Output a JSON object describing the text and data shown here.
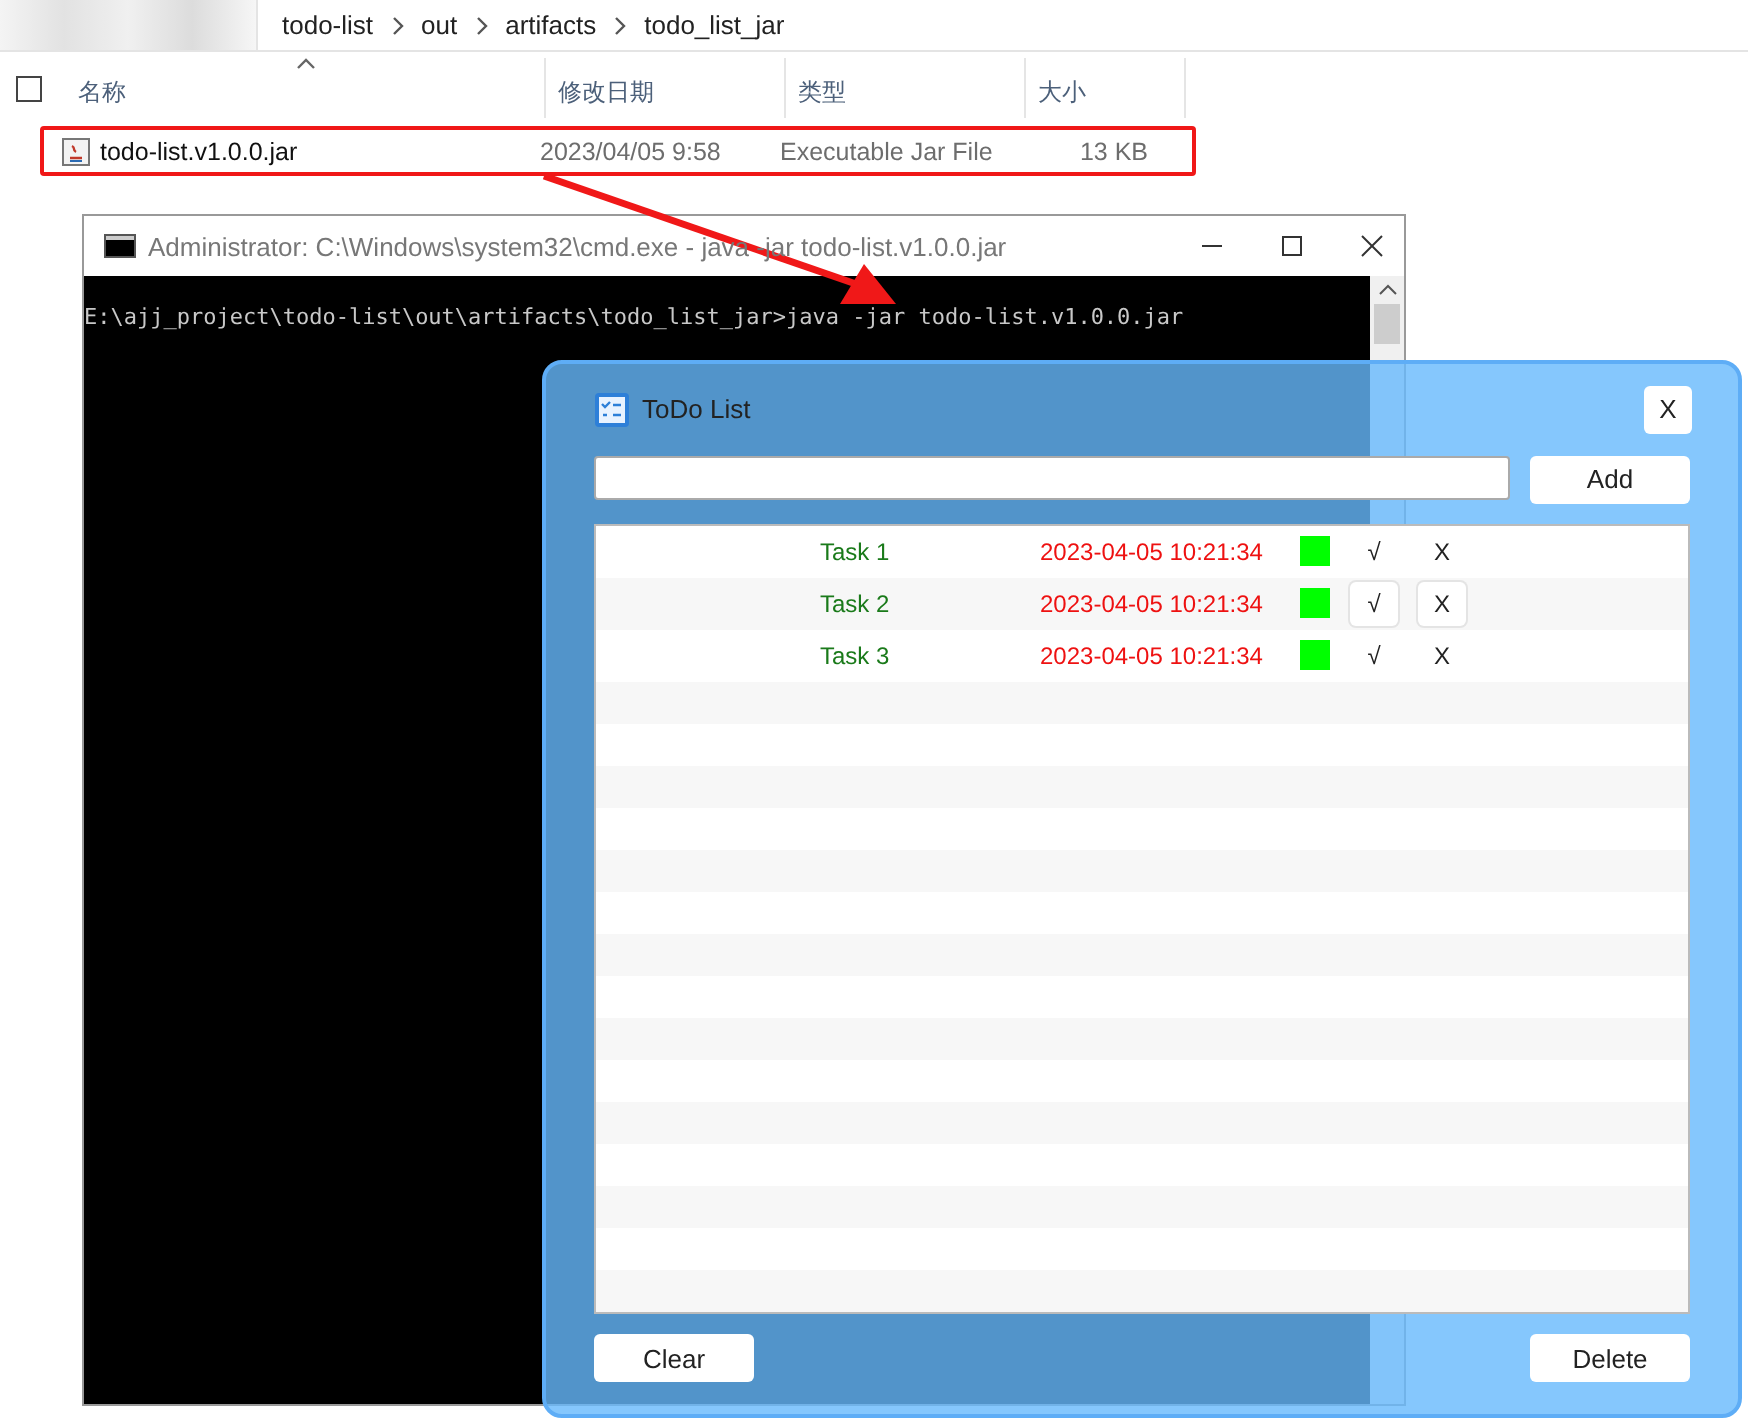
{
  "explorer": {
    "select_all": {
      "checked": false
    },
    "breadcrumbs": [
      "todo-list",
      "out",
      "artifacts",
      "todo_list_jar"
    ],
    "columns": [
      {
        "label": "名称",
        "sorted": true
      },
      {
        "label": "修改日期",
        "sorted": false
      },
      {
        "label": "类型",
        "sorted": false
      },
      {
        "label": "大小",
        "sorted": false
      }
    ],
    "files": [
      {
        "name": "todo-list.v1.0.0.jar",
        "modified": "2023/04/05 9:58",
        "type": "Executable Jar File",
        "size": "13 KB",
        "highlighted": true
      }
    ]
  },
  "console": {
    "title": "Administrator: C:\\Windows\\system32\\cmd.exe - java -jar todo-list.v1.0.0.jar",
    "lines": [
      "E:\\ajj_project\\todo-list\\out\\artifacts\\todo_list_jar>java -jar todo-list.v1.0.0.jar"
    ]
  },
  "todo": {
    "title": "ToDo List",
    "close": "X",
    "add": "Add",
    "tasks": [
      {
        "name": "Task 1",
        "time": "2023-04-05 10:21:34",
        "color": "#00ff00",
        "done": "√",
        "remove": "X",
        "hovered": false
      },
      {
        "name": "Task 2",
        "time": "2023-04-05 10:21:34",
        "color": "#00ff00",
        "done": "√",
        "remove": "X",
        "hovered": true
      },
      {
        "name": "Task 3",
        "time": "2023-04-05 10:21:34",
        "color": "#00ff00",
        "done": "√",
        "remove": "X",
        "hovered": false
      }
    ],
    "clear": "Clear",
    "delete": "Delete"
  }
}
